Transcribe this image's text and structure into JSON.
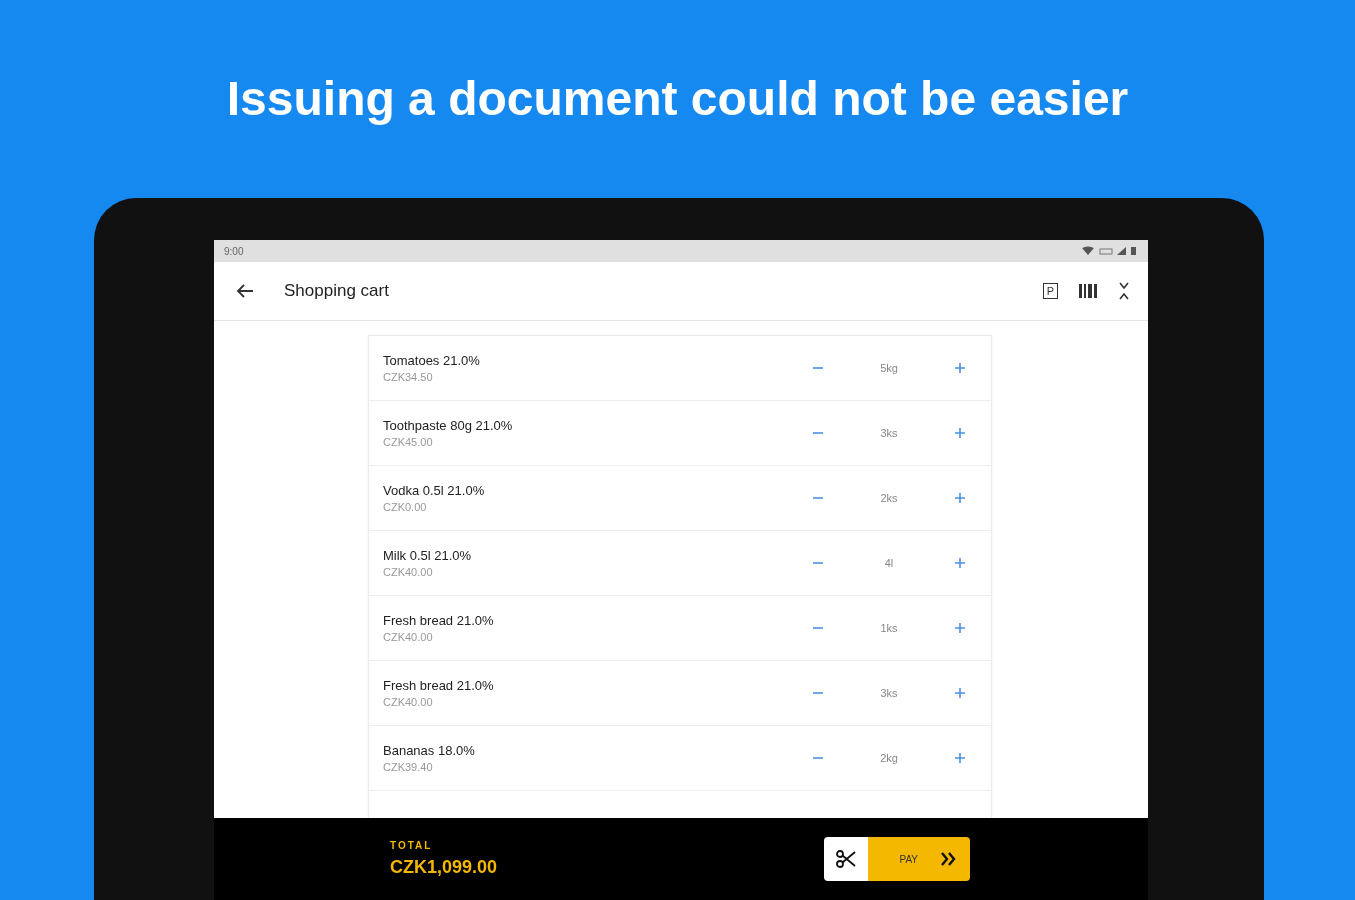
{
  "headline": "Issuing a document could not be easier",
  "status_bar": {
    "time": "9:00"
  },
  "app_bar": {
    "title": "Shopping cart",
    "badge_letter": "P"
  },
  "cart_items": [
    {
      "name": "Tomatoes 21.0%",
      "price": "CZK34.50",
      "quantity": "5kg"
    },
    {
      "name": "Toothpaste 80g 21.0%",
      "price": "CZK45.00",
      "quantity": "3ks"
    },
    {
      "name": "Vodka 0.5l 21.0%",
      "price": "CZK0.00",
      "quantity": "2ks"
    },
    {
      "name": "Milk 0.5l 21.0%",
      "price": "CZK40.00",
      "quantity": "4l"
    },
    {
      "name": "Fresh bread 21.0%",
      "price": "CZK40.00",
      "quantity": "1ks"
    },
    {
      "name": "Fresh bread 21.0%",
      "price": "CZK40.00",
      "quantity": "3ks"
    },
    {
      "name": "Bananas 18.0%",
      "price": "CZK39.40",
      "quantity": "2kg"
    }
  ],
  "footer": {
    "total_label": "TOTAL",
    "total": "CZK1,099.00",
    "pay_button": "PAY"
  }
}
